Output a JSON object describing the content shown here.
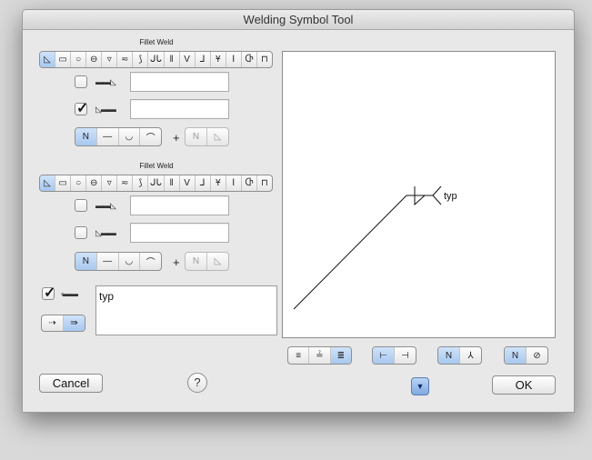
{
  "window": {
    "title": "Welding Symbol Tool"
  },
  "arrow_side": {
    "section_label": "Fillet Weld",
    "weld_types": [
      "fillet-icon",
      "square-icon",
      "plug-icon",
      "spot-icon",
      "seam-icon",
      "surfacing-icon",
      "j-groove-icon",
      "j-groove-double-icon",
      "square-groove-icon",
      "v-groove-icon",
      "bevel-groove-icon",
      "u-groove-icon",
      "flare-v-icon",
      "flare-bevel-icon",
      "edge-icon"
    ],
    "weld_type_glyphs": [
      "◺",
      "▭",
      "○",
      "⊖",
      "▿",
      "≂",
      "⟆",
      "ᒍᒐ",
      "‖",
      "V",
      "⅃",
      "Ұ",
      "Ⅰ",
      "Ⴇ",
      "⊓"
    ],
    "selected_weld_index": 0,
    "row1": {
      "checked": false,
      "value": ""
    },
    "row2": {
      "checked": true,
      "value": ""
    },
    "contour_buttons": [
      "N",
      "—",
      "◡",
      "⌒"
    ],
    "contour_selected": 0,
    "finish_buttons": [
      "N",
      "◺"
    ],
    "plus_label": "+"
  },
  "other_side": {
    "section_label": "Fillet Weld",
    "weld_type_glyphs": [
      "◺",
      "▭",
      "○",
      "⊖",
      "▿",
      "≂",
      "⟆",
      "ᒍᒐ",
      "‖",
      "V",
      "⅃",
      "Ұ",
      "Ⅰ",
      "Ⴇ",
      "⊓"
    ],
    "selected_weld_index": 0,
    "row1": {
      "checked": false,
      "value": ""
    },
    "row2": {
      "checked": false,
      "value": ""
    },
    "contour_buttons": [
      "N",
      "—",
      "◡",
      "⌒"
    ],
    "contour_selected": 0,
    "finish_buttons": [
      "N",
      "◺"
    ],
    "plus_label": "+"
  },
  "tail": {
    "checked": true,
    "text": "typ",
    "arrow_buttons": [
      "⇢",
      "⇛"
    ],
    "arrow_selected": 1
  },
  "preview": {
    "tail_text": "typ"
  },
  "preview_buttons": {
    "group1": [
      "≡",
      "≟",
      "≣"
    ],
    "group1_selected": 2,
    "group2": [
      "⊢",
      "⊣"
    ],
    "group2_selected": 0,
    "group3": [
      "N",
      "⅄"
    ],
    "group3_selected": 0,
    "group4": [
      "N",
      "⊘"
    ],
    "group4_selected": 0
  },
  "buttons": {
    "cancel": "Cancel",
    "help": "?",
    "ok": "OK",
    "disclosure": "▼"
  }
}
